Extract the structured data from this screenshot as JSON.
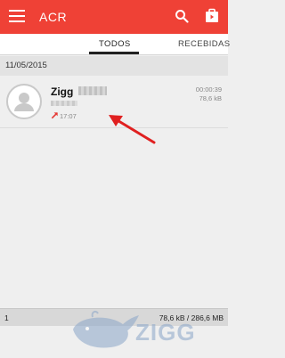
{
  "appbar": {
    "title": "ACR",
    "background": "#ef4136",
    "icons": [
      "menu-icon",
      "search-icon",
      "store-icon"
    ]
  },
  "tabs": [
    {
      "label": "TODOS",
      "selected": true
    },
    {
      "label": "RECEBIDAS",
      "selected": false
    }
  ],
  "list": {
    "date_header": "11/05/2015",
    "items": [
      {
        "contact_name": "Zigg",
        "time": "17:07",
        "duration": "00:00:39",
        "size": "78,6 kB",
        "direction_icon": "outgoing-call-arrow-icon"
      }
    ]
  },
  "footer": {
    "count": "1",
    "storage": "78,6 kB / 286,6 MB"
  },
  "watermark": {
    "text": "ZIGG"
  }
}
